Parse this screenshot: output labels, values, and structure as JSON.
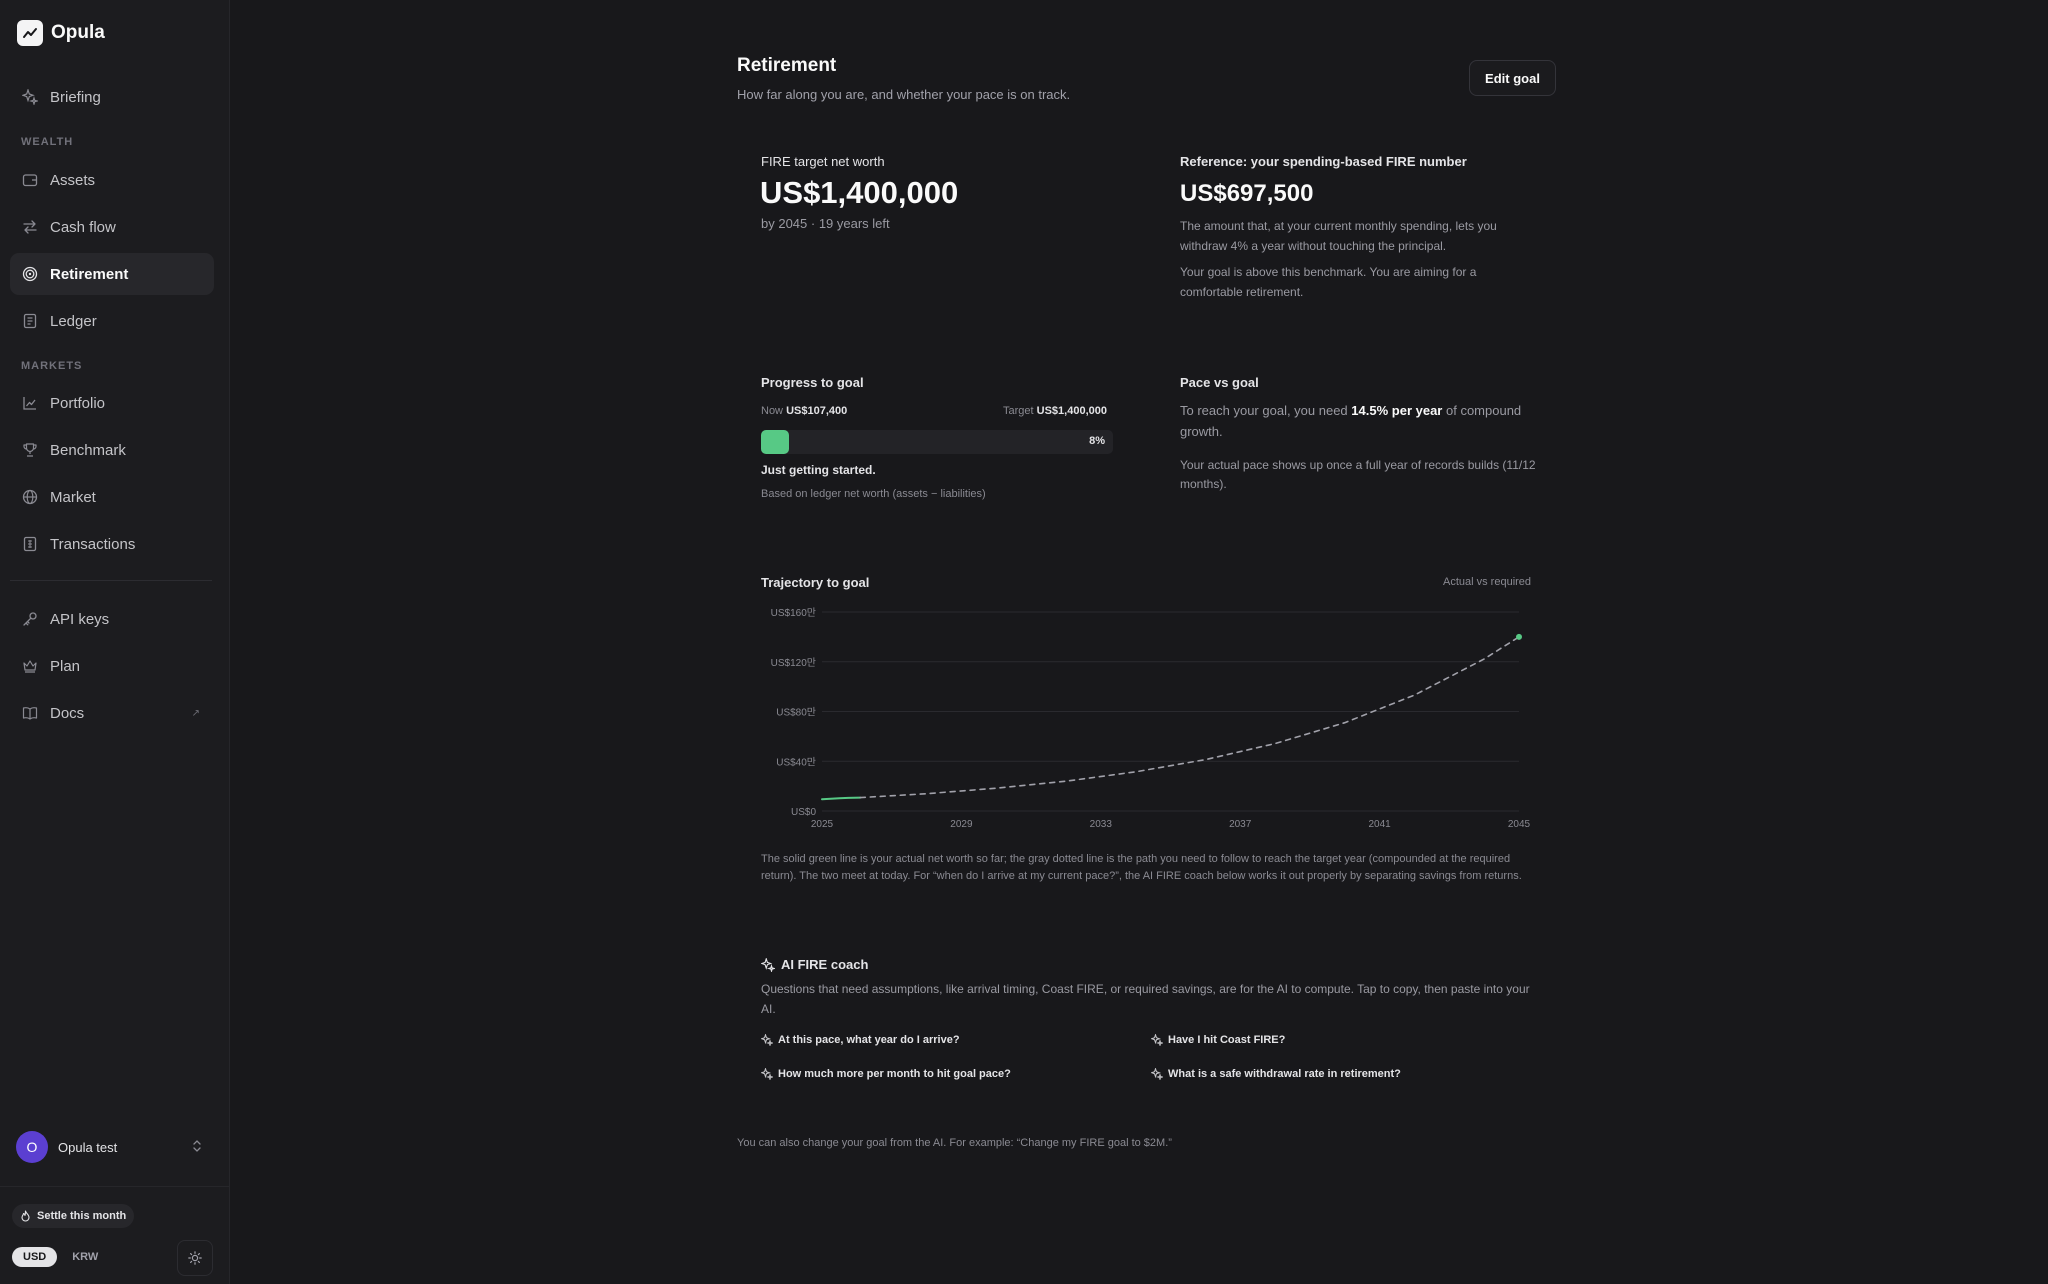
{
  "brand": {
    "name": "Opula"
  },
  "sidebar": {
    "briefing": "Briefing",
    "section_wealth": "WEALTH",
    "assets": "Assets",
    "cash_flow": "Cash flow",
    "retirement": "Retirement",
    "ledger": "Ledger",
    "section_markets": "MARKETS",
    "portfolio": "Portfolio",
    "benchmark": "Benchmark",
    "market": "Market",
    "transactions": "Transactions",
    "api_keys": "API keys",
    "plan": "Plan",
    "docs": "Docs",
    "docs_external": "↗",
    "user_initial": "O",
    "user_name": "Opula test",
    "settle": "Settle this month",
    "currency_usd": "USD",
    "currency_krw": "KRW",
    "selected_currency": "USD"
  },
  "header": {
    "title": "Retirement",
    "subtitle": "How far along you are, and whether your pace is on track.",
    "edit_button": "Edit goal"
  },
  "target": {
    "label": "FIRE target net worth",
    "value": "US$1,400,000",
    "sub": "by 2045 · 19 years left"
  },
  "reference": {
    "label": "Reference: your spending-based FIRE number",
    "value": "US$697,500",
    "desc1": "The amount that, at your current monthly spending, lets you",
    "desc2": "withdraw 4% a year without touching the principal.",
    "note1": "Your goal is above this benchmark. You are aiming for a",
    "note2": "comfortable retirement."
  },
  "progress": {
    "label": "Progress to goal",
    "now_key": "Now",
    "now_value": "US$107,400",
    "target_key": "Target",
    "target_value": "US$1,400,000",
    "percent_text": "8%",
    "percent": 0.08,
    "status": "Just getting started.",
    "note": "Based on ledger net worth (assets − liabilities)"
  },
  "pace": {
    "label": "Pace vs goal",
    "line1_pre": "To reach your goal, you need",
    "line1_rate": "14.5% per year",
    "line1_post": "of compound",
    "line2": "growth.",
    "note1": "Your actual pace shows up once a full year of records builds (11/12",
    "note2": "months)."
  },
  "trajectory": {
    "label": "Trajectory to goal",
    "legend": "Actual vs required",
    "caption1": "The solid green line is your actual net worth so far; the gray dotted line is the path you need to follow to reach the target year (compounded at the required",
    "caption2": "return). The two meet at today. For “when do I arrive at my current pace?”, the AI FIRE coach below works it out properly by separating savings from returns."
  },
  "chart_data": {
    "type": "line",
    "title": "Trajectory to goal",
    "y_tick_labels": [
      "US$0",
      "US$40만",
      "US$80만",
      "US$120만",
      "US$160만"
    ],
    "y_ticks": [
      0,
      400000,
      800000,
      1200000,
      1600000
    ],
    "ylim": [
      0,
      1600000
    ],
    "x_tick_labels": [
      "2025",
      "2029",
      "2033",
      "2037",
      "2041",
      "2045"
    ],
    "xlim": [
      2025,
      2045
    ],
    "grid": true,
    "series": [
      {
        "name": "Actual",
        "style": "solid",
        "color": "#57c985",
        "x": [
          2025.0,
          2025.25,
          2025.5,
          2025.75,
          2026.1
        ],
        "y": [
          95000,
          99000,
          102000,
          105000,
          107400
        ]
      },
      {
        "name": "Required",
        "style": "dotted",
        "color": "#a1a1aa",
        "x": [
          2026.1,
          2028,
          2030,
          2032,
          2034,
          2036,
          2038,
          2040,
          2042,
          2044,
          2045
        ],
        "y": [
          107400,
          139000,
          183000,
          240000,
          315000,
          413000,
          542000,
          710000,
          932000,
          1222000,
          1400000
        ]
      }
    ],
    "end_point": {
      "x": 2045,
      "y": 1400000,
      "color": "#57c985"
    }
  },
  "coach": {
    "title": "AI FIRE coach",
    "desc1": "Questions that need assumptions, like arrival timing, Coast FIRE, or required savings, are for the AI to compute. Tap to copy, then paste into your",
    "desc2": "AI.",
    "q1": "At this pace, what year do I arrive?",
    "q2": "Have I hit Coast FIRE?",
    "q3": "How much more per month to hit goal pace?",
    "q4": "What is a safe withdrawal rate in retirement?"
  },
  "footer_note": "You can also change your goal from the AI. For example: “Change my FIRE goal to $2M.”",
  "colors": {
    "accent": "#57c985",
    "background": "#18181b",
    "sidebar": "#1c1c1f",
    "avatar": "#5b3fd1"
  }
}
